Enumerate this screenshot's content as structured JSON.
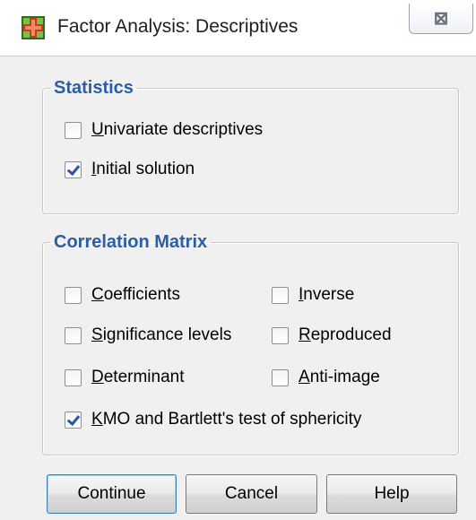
{
  "window": {
    "title": "Factor Analysis: Descriptives",
    "close_glyph": "⊠",
    "icon": "plus-table-icon"
  },
  "statistics": {
    "legend": "Statistics",
    "options": [
      {
        "mnemonic": "U",
        "rest": "nivariate descriptives",
        "checked": false
      },
      {
        "mnemonic": "I",
        "rest": "nitial solution",
        "checked": true
      }
    ]
  },
  "correlation": {
    "legend": "Correlation Matrix",
    "options": [
      {
        "mnemonic": "C",
        "rest": "oefficients",
        "checked": false
      },
      {
        "mnemonic": "I",
        "rest": "nverse",
        "checked": false
      },
      {
        "mnemonic": "S",
        "rest": "ignificance levels",
        "checked": false
      },
      {
        "mnemonic": "R",
        "rest": "eproduced",
        "checked": false
      },
      {
        "mnemonic": "D",
        "rest": "eterminant",
        "checked": false
      },
      {
        "mnemonic": "A",
        "rest": "nti-image",
        "checked": false
      },
      {
        "mnemonic": "K",
        "rest": "MO and Bartlett's test of sphericity",
        "checked": true
      }
    ]
  },
  "buttons": {
    "continue": "Continue",
    "cancel": "Cancel",
    "help": "Help"
  }
}
